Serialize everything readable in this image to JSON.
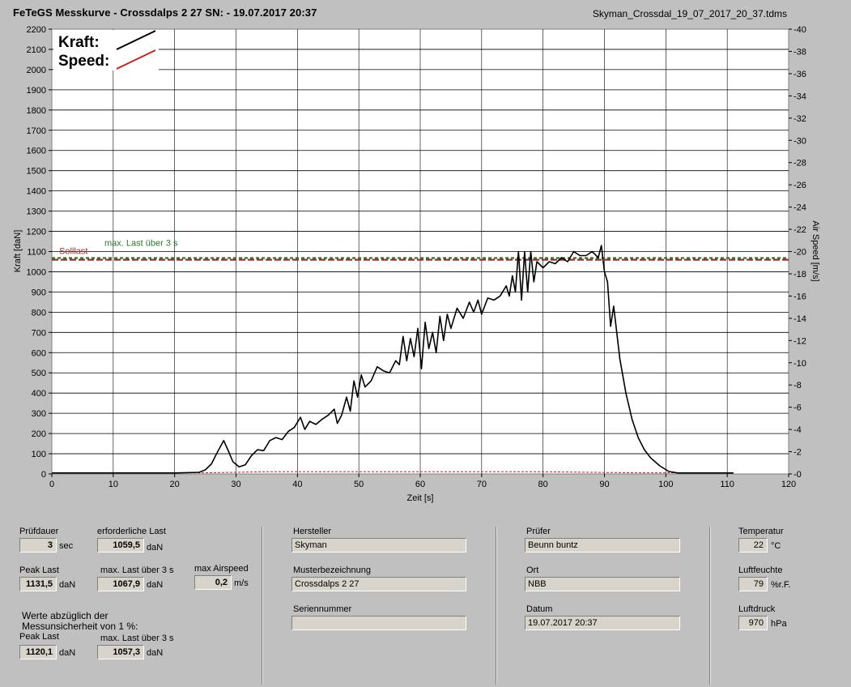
{
  "window": {
    "title": "FeTeGS Messkurve - Crossdalps 2 27  SN:  - 19.07.2017 20:37",
    "filename": "Skyman_Crossdal_19_07_2017_20_37.tdms"
  },
  "chart_data": {
    "type": "line",
    "xlabel": "Zeit [s]",
    "ylabel": "Kraft [daN]",
    "y2label": "Air Speed [m/s]",
    "xlim": [
      0,
      120
    ],
    "ylim": [
      0,
      2200
    ],
    "y2lim": [
      0,
      40
    ],
    "x_ticks": [
      0,
      10,
      20,
      30,
      40,
      50,
      60,
      70,
      80,
      90,
      100,
      110,
      120
    ],
    "y_ticks": [
      0,
      100,
      200,
      300,
      400,
      500,
      600,
      700,
      800,
      900,
      1000,
      1100,
      1200,
      1300,
      1400,
      1500,
      1600,
      1700,
      1800,
      1900,
      2000,
      2100,
      2200
    ],
    "y2_ticks": [
      0,
      2,
      4,
      6,
      8,
      10,
      12,
      14,
      16,
      18,
      20,
      22,
      24,
      26,
      28,
      30,
      32,
      34,
      36,
      38,
      40
    ],
    "grid": true,
    "legend": [
      {
        "name": "Kraft:",
        "color": "#000000"
      },
      {
        "name": "Speed:",
        "color": "#d02020"
      }
    ],
    "reference_lines": [
      {
        "name": "Solllast",
        "value": 1059.5,
        "color": "#a03030"
      },
      {
        "name": "max. Last über  3 s",
        "value": 1067.9,
        "color": "#2a7a2a"
      }
    ],
    "series": [
      {
        "name": "Kraft:",
        "axis": "left",
        "color": "#000000",
        "points": [
          [
            0,
            5
          ],
          [
            20,
            5
          ],
          [
            24,
            8
          ],
          [
            25,
            20
          ],
          [
            26,
            50
          ],
          [
            27,
            110
          ],
          [
            28,
            165
          ],
          [
            28.8,
            110
          ],
          [
            29.5,
            60
          ],
          [
            30.5,
            35
          ],
          [
            31.5,
            45
          ],
          [
            32.5,
            90
          ],
          [
            33.5,
            120
          ],
          [
            34.5,
            115
          ],
          [
            35.5,
            165
          ],
          [
            36.5,
            180
          ],
          [
            37.5,
            170
          ],
          [
            38.5,
            210
          ],
          [
            39.5,
            230
          ],
          [
            40.5,
            280
          ],
          [
            41.2,
            220
          ],
          [
            42,
            260
          ],
          [
            43,
            245
          ],
          [
            44,
            270
          ],
          [
            45,
            290
          ],
          [
            46,
            320
          ],
          [
            46.5,
            250
          ],
          [
            47.2,
            290
          ],
          [
            48,
            380
          ],
          [
            48.6,
            310
          ],
          [
            49.2,
            460
          ],
          [
            49.8,
            380
          ],
          [
            50.4,
            490
          ],
          [
            51,
            430
          ],
          [
            52,
            460
          ],
          [
            53,
            530
          ],
          [
            54,
            510
          ],
          [
            55,
            500
          ],
          [
            56,
            560
          ],
          [
            56.6,
            540
          ],
          [
            57.2,
            680
          ],
          [
            57.8,
            560
          ],
          [
            58.4,
            670
          ],
          [
            59,
            580
          ],
          [
            59.6,
            720
          ],
          [
            60.2,
            520
          ],
          [
            60.8,
            750
          ],
          [
            61.4,
            620
          ],
          [
            62,
            700
          ],
          [
            62.6,
            600
          ],
          [
            63.2,
            780
          ],
          [
            63.8,
            660
          ],
          [
            64.4,
            790
          ],
          [
            65,
            720
          ],
          [
            66,
            820
          ],
          [
            67,
            770
          ],
          [
            68,
            850
          ],
          [
            68.7,
            800
          ],
          [
            69.4,
            860
          ],
          [
            70,
            790
          ],
          [
            71,
            870
          ],
          [
            72,
            860
          ],
          [
            73,
            880
          ],
          [
            74,
            930
          ],
          [
            74.5,
            880
          ],
          [
            75,
            980
          ],
          [
            75.5,
            900
          ],
          [
            76,
            1100
          ],
          [
            76.5,
            860
          ],
          [
            77,
            1100
          ],
          [
            77.5,
            900
          ],
          [
            78,
            1100
          ],
          [
            78.5,
            950
          ],
          [
            79,
            1050
          ],
          [
            80,
            1020
          ],
          [
            81,
            1050
          ],
          [
            82,
            1040
          ],
          [
            83,
            1070
          ],
          [
            84,
            1050
          ],
          [
            85,
            1100
          ],
          [
            86,
            1080
          ],
          [
            87,
            1080
          ],
          [
            88,
            1100
          ],
          [
            89,
            1070
          ],
          [
            89.5,
            1130
          ],
          [
            90,
            1000
          ],
          [
            90.5,
            950
          ],
          [
            91,
            730
          ],
          [
            91.5,
            830
          ],
          [
            92.5,
            570
          ],
          [
            93.5,
            400
          ],
          [
            94.5,
            270
          ],
          [
            95.5,
            180
          ],
          [
            96.5,
            120
          ],
          [
            97.5,
            80
          ],
          [
            99,
            40
          ],
          [
            100.5,
            12
          ],
          [
            102,
            5
          ],
          [
            111,
            5
          ]
        ]
      },
      {
        "name": "Speed:",
        "axis": "right",
        "color": "#d02020",
        "points": [
          [
            0,
            0.1
          ],
          [
            25,
            0.1
          ],
          [
            35,
            0.2
          ],
          [
            60,
            0.2
          ],
          [
            80,
            0.2
          ],
          [
            95,
            0.1
          ],
          [
            111,
            0.1
          ]
        ]
      }
    ]
  },
  "panel": {
    "pruefdauer": {
      "label": "Prüfdauer",
      "value": "3",
      "unit": "sec"
    },
    "erforderliche_last": {
      "label": "erforderliche Last",
      "value": "1059,5",
      "unit": "daN"
    },
    "peak_last": {
      "label": "Peak Last",
      "value": "1131,5",
      "unit": "daN"
    },
    "max_last": {
      "label": "max. Last über  3 s",
      "value": "1067,9",
      "unit": "daN"
    },
    "max_airspeed": {
      "label": "max Airspeed",
      "value": "0,2",
      "unit": "m/s"
    },
    "werte_note": "Werte abzüglich der Messunsicherheit von 1  %:",
    "peak_last_corr": {
      "label": "Peak Last",
      "value": "1120,1",
      "unit": "daN"
    },
    "max_last_corr": {
      "label": "max. Last über  3 s",
      "value": "1057,3",
      "unit": "daN"
    },
    "hersteller": {
      "label": "Hersteller",
      "value": "Skyman"
    },
    "musterbezeichnung": {
      "label": "Musterbezeichnung",
      "value": "Crossdalps 2 27"
    },
    "seriennummer": {
      "label": "Seriennummer",
      "value": ""
    },
    "pruefer": {
      "label": "Prüfer",
      "value": "Beunn buntz"
    },
    "ort": {
      "label": "Ort",
      "value": "NBB"
    },
    "datum": {
      "label": "Datum",
      "value": "19.07.2017 20:37"
    },
    "temperatur": {
      "label": "Temperatur",
      "value": "22",
      "unit": "°C"
    },
    "luftfeuchte": {
      "label": "Luftfeuchte",
      "value": "79",
      "unit": "%r.F."
    },
    "luftdruck": {
      "label": "Luftdruck",
      "value": "970",
      "unit": "hPa"
    }
  }
}
